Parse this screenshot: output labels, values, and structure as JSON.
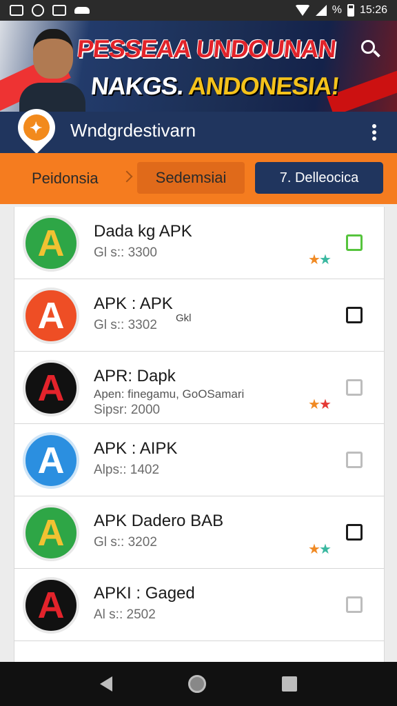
{
  "status_bar": {
    "time": "15:26",
    "signal_label": "%"
  },
  "banner": {
    "headline_line1": "PESSEAA UNDOUNAN",
    "headline_line2_white": "NAKGS.",
    "headline_line2_yellow": "ANDONESIA!"
  },
  "app_bar": {
    "title": "Wndgrdestivarn"
  },
  "nav": {
    "crumb_first": "Peidonsia",
    "crumb_current": "Sedemsiai",
    "action_button": "7. Delleocica"
  },
  "apps": [
    {
      "title": "Dada kg APK",
      "subtitle": "Gl s:: 3300",
      "icon_letter": "A",
      "icon_style": "green",
      "check": "green",
      "stars": [
        "orange",
        "teal"
      ]
    },
    {
      "title": "APK : APK",
      "subtitle": "Gl s:: 3302",
      "tag": "Gkl",
      "icon_letter": "A",
      "icon_style": "orange",
      "check": "dark",
      "stars": []
    },
    {
      "title": "APR: Dapk",
      "subtitle": "Sipsr: 2000",
      "extra": "Apen: finegamu, GoOSamari",
      "icon_letter": "A",
      "icon_style": "black",
      "check": "light",
      "stars": [
        "orange",
        "red"
      ]
    },
    {
      "title": "APK : AIPK",
      "subtitle": "Alps:: 1402",
      "icon_letter": "A",
      "icon_style": "blue",
      "check": "light",
      "stars": []
    },
    {
      "title": "APK Dadero BAB",
      "subtitle": "Gl s:: 3202",
      "icon_letter": "A",
      "icon_style": "green",
      "check": "dark",
      "stars": [
        "orange",
        "teal"
      ]
    },
    {
      "title": "APKI : Gaged",
      "subtitle": "Al s:: 2502",
      "icon_letter": "A",
      "icon_style": "black",
      "check": "light",
      "stars": []
    }
  ],
  "colors": {
    "accent_orange": "#f57c1f",
    "navy": "#20355e",
    "star_orange": "#f08a24",
    "star_teal": "#3ab8a0",
    "star_red": "#e53935"
  }
}
